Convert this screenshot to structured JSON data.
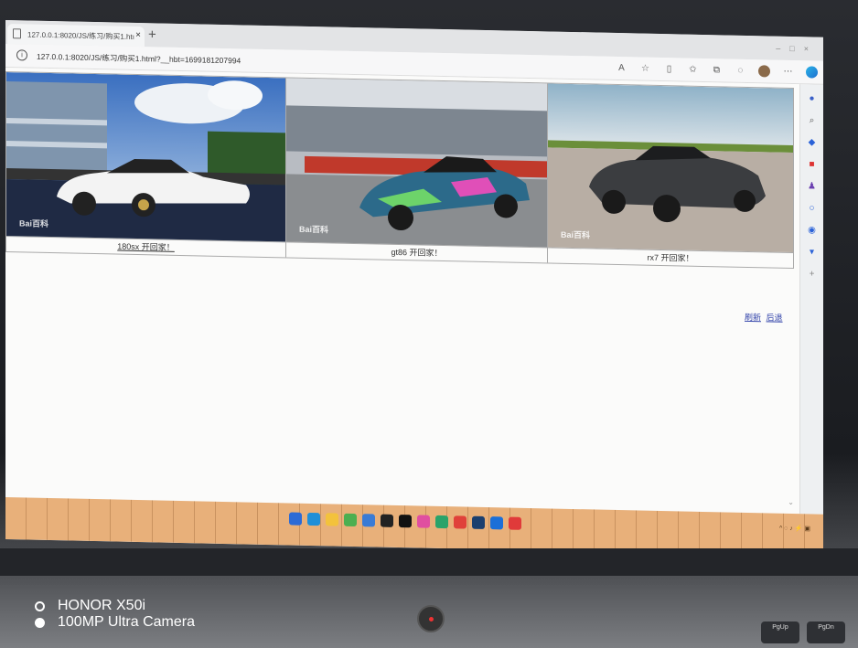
{
  "browser": {
    "tab_title": "127.0.0.1:8020/JS/练习/购买1.htı",
    "tab_close": "×",
    "new_tab": "+",
    "url": "127.0.0.1:8020/JS/练习/购买1.html?__hbt=1699181207994",
    "info_icon": "i"
  },
  "gallery": [
    {
      "caption": "180sx 开回家！",
      "watermark": "Bai百科",
      "linked": true
    },
    {
      "caption": "gt86 开回家！",
      "watermark": "Bai百科",
      "linked": false
    },
    {
      "caption": "rx7 开回家！",
      "watermark": "Bai百科",
      "linked": false
    }
  ],
  "page_links": {
    "refresh": "刷新",
    "back": "后退"
  },
  "camera": {
    "model": "HONOR X50i",
    "camera": "100MP Ultra Camera"
  },
  "keys": [
    "PgUp",
    "PgDn"
  ],
  "colors": {
    "link": "#3344aa",
    "taskbar": "#e8b07a"
  },
  "icons": [
    "page-icon",
    "info-icon",
    "read-aloud-icon",
    "favorite-icon",
    "collections-icon",
    "profile-avatar",
    "edge-icon"
  ]
}
